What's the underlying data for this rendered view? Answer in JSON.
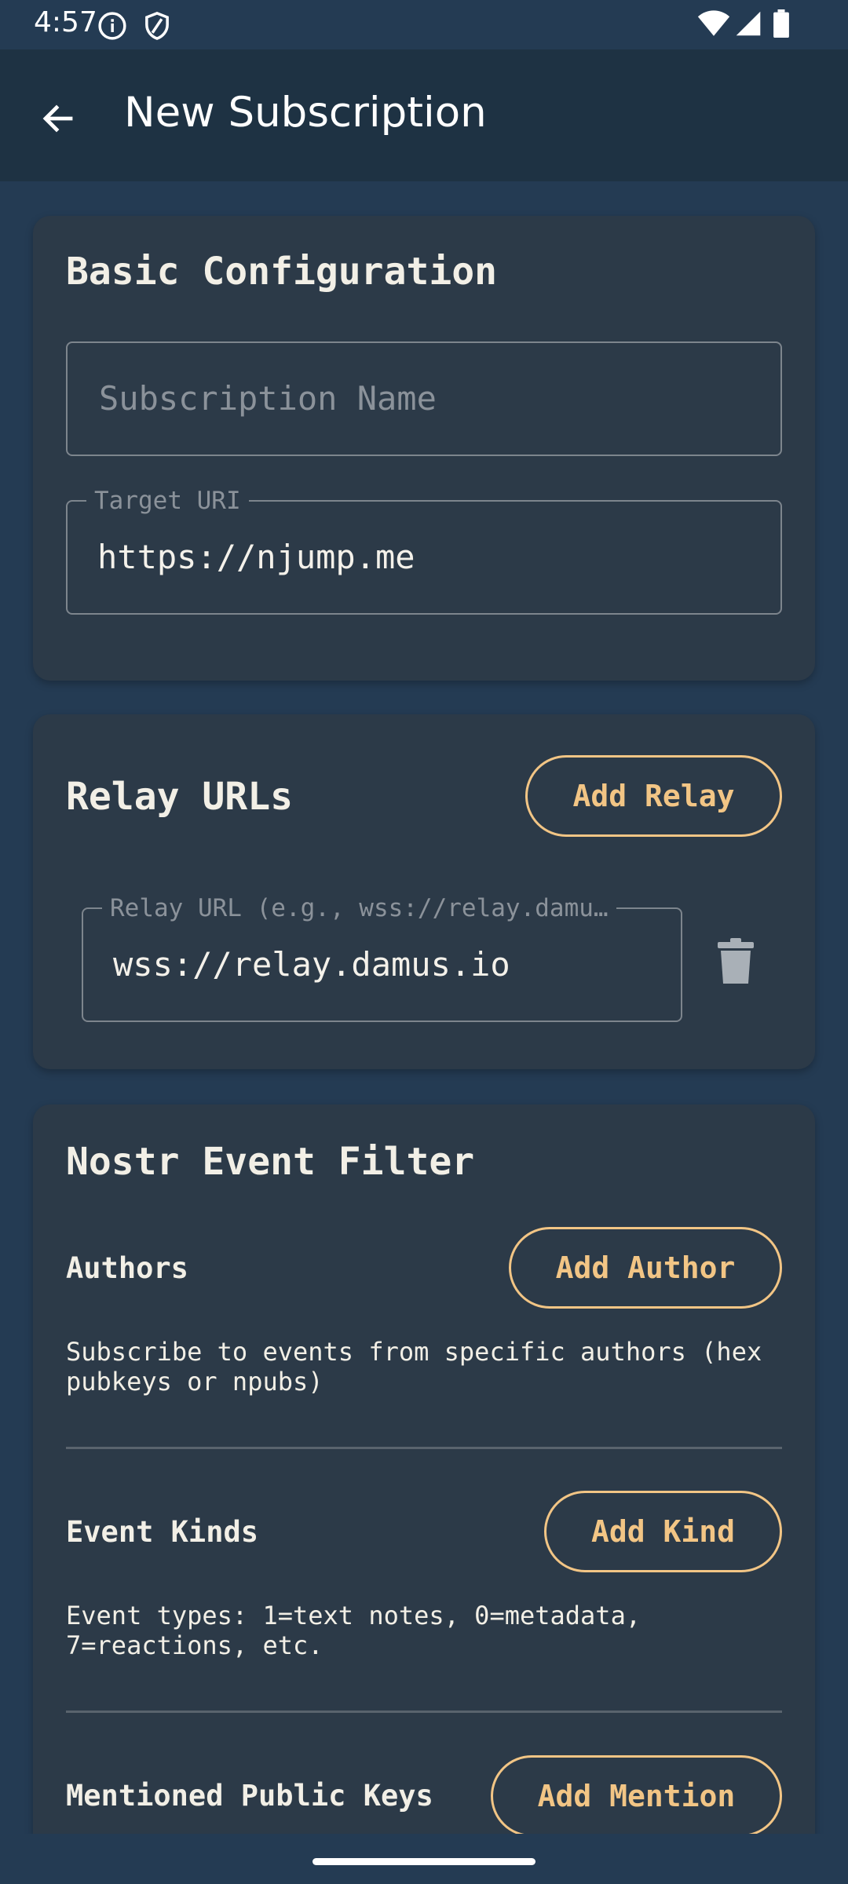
{
  "status_bar": {
    "time": "4:57",
    "icons": [
      "info-icon",
      "shield-icon",
      "wifi-icon",
      "signal-icon",
      "battery-icon"
    ]
  },
  "app_bar": {
    "title": "New Subscription",
    "back_icon": "arrow-left-icon"
  },
  "basic_config": {
    "title": "Basic Configuration",
    "name_placeholder": "Subscription Name",
    "target_label": "Target URI",
    "target_value": "https://njump.me"
  },
  "relays": {
    "title": "Relay URLs",
    "add_label": "Add Relay",
    "items": [
      {
        "label": "Relay URL (e.g., wss://relay.damu…",
        "value": "wss://relay.damus.io"
      }
    ],
    "delete_icon": "trash-icon"
  },
  "filter": {
    "title": "Nostr Event Filter",
    "authors": {
      "label": "Authors",
      "button": "Add Author",
      "help": "Subscribe to events from specific authors (hex pubkeys or npubs)"
    },
    "kinds": {
      "label": "Event Kinds",
      "button": "Add Kind",
      "help": "Event types: 1=text notes, 0=metadata, 7=reactions, etc."
    },
    "mentions": {
      "label": "Mentioned Public Keys",
      "button": "Add Mention"
    }
  },
  "colors": {
    "background": "#243b53",
    "card": "#2c3a48",
    "accent": "#f2c585",
    "app_bar": "#1e3243"
  }
}
